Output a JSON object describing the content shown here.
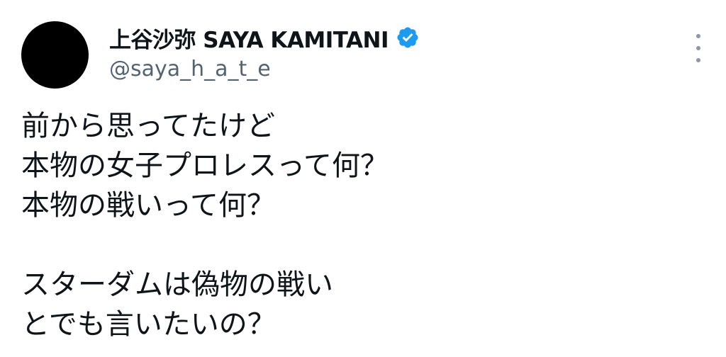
{
  "author": {
    "display_name": "上谷沙弥 SAYA KAMITANI",
    "handle": "@saya_h_a_t_e",
    "verified": true,
    "verified_color": "#1d9bf0",
    "avatar_color": "#000000"
  },
  "tweet": {
    "lines": [
      "前から思ってたけど",
      "本物の女子プロレスって何？",
      "本物の戦いって何？",
      "",
      "スターダムは偽物の戦い",
      "とでも言いたいの？"
    ]
  },
  "icons": {
    "verified": "verified-badge-icon",
    "more": "more-options-icon"
  }
}
